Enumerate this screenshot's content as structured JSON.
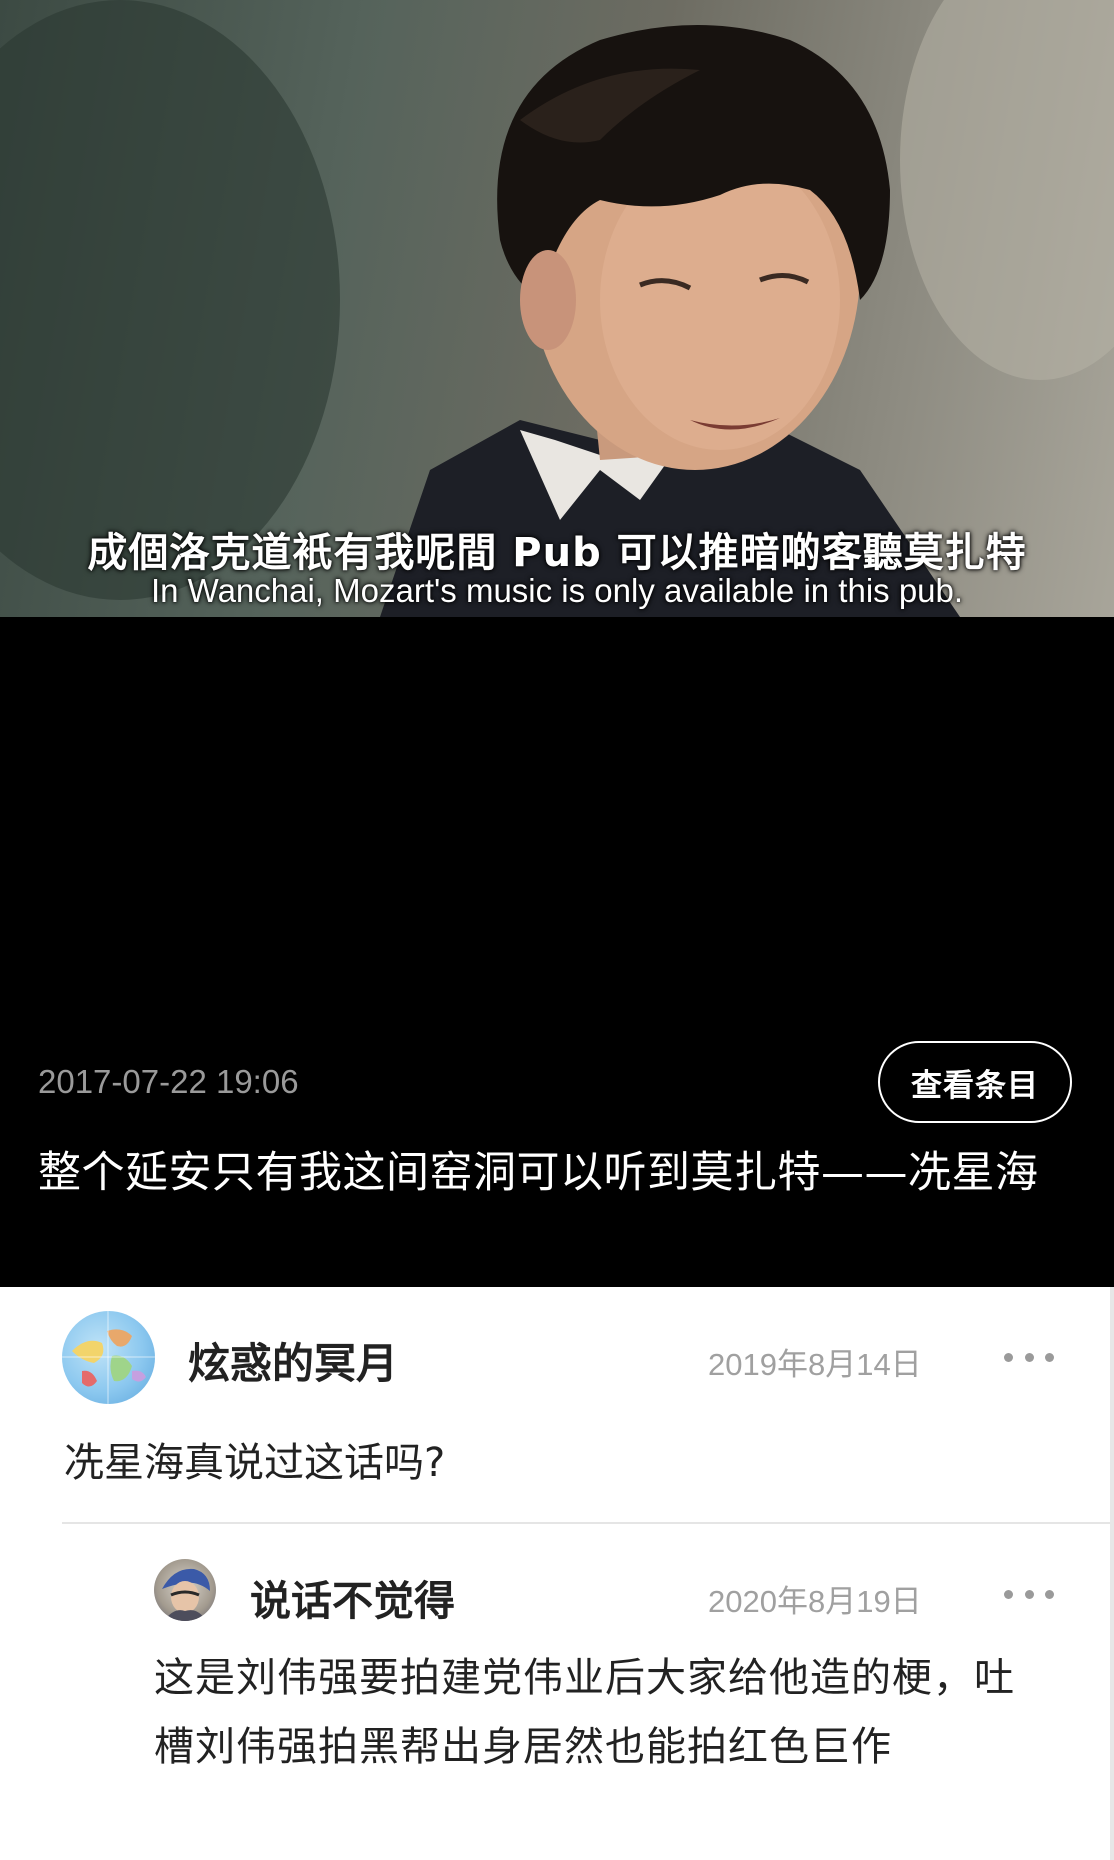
{
  "video": {
    "subtitle_cn": "成個洛克道衹有我呢間 Pub 可以推暗啲客聽莫扎特",
    "subtitle_en": "In Wanchai, Mozart's music is only available in this pub."
  },
  "post": {
    "date": "2017-07-22 19:06",
    "view_button_label": "查看条目",
    "text": "整个延安只有我这间窑洞可以听到莫扎特——冼星海"
  },
  "comments": [
    {
      "author": "炫惑的冥月",
      "date": "2019年8月14日",
      "text": "冼星海真说过这话吗?",
      "avatar_icon": "globe-avatar-icon"
    },
    {
      "author": "说话不觉得",
      "date": "2020年8月19日",
      "text": "这是刘伟强要拍建党伟业后大家给他造的梗，吐槽刘伟强拍黑帮出身居然也能拍红色巨作",
      "avatar_icon": "character-avatar-icon"
    }
  ],
  "colors": {
    "background_dark": "#000000",
    "background_light": "#ffffff",
    "muted_text": "#9a9a9a",
    "body_text": "#222222"
  }
}
